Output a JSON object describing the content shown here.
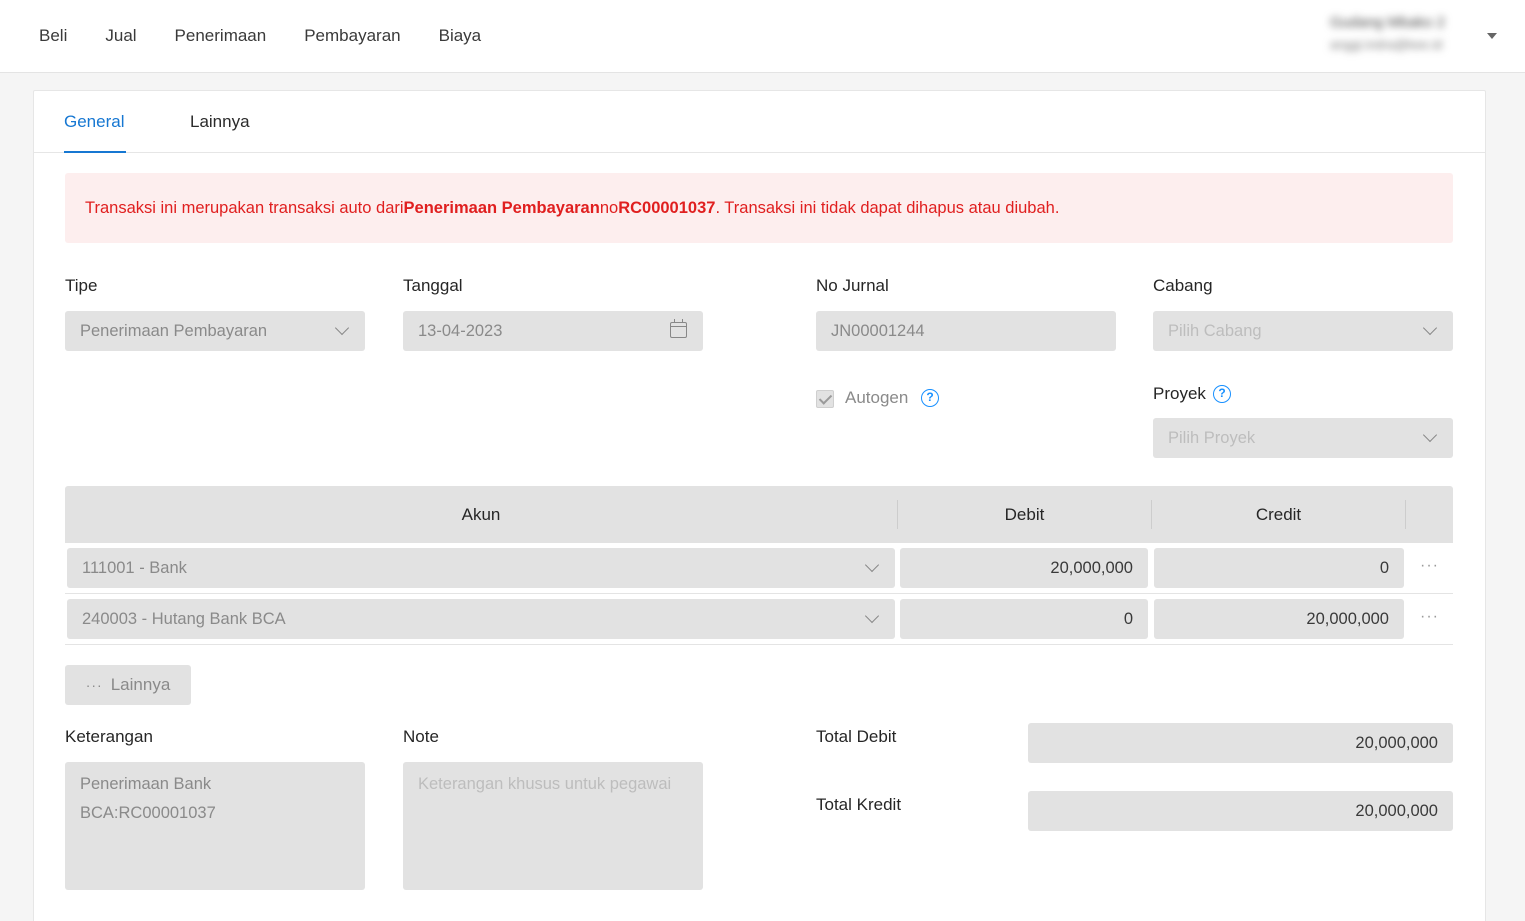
{
  "nav": {
    "items": [
      "Beli",
      "Jual",
      "Penerimaan",
      "Pembayaran",
      "Biaya"
    ],
    "user_name": "Gudang Mbako 2",
    "user_email": "anggi.indra@kee.id"
  },
  "tabs": [
    "General",
    "Lainnya"
  ],
  "alert": {
    "prefix": "Transaksi ini merupakan transaksi auto dari ",
    "source": "Penerimaan Pembayaran",
    "middle": " no ",
    "ref": "RC00001037",
    "suffix": ". Transaksi ini tidak dapat dihapus atau diubah."
  },
  "form": {
    "tipe_label": "Tipe",
    "tipe_value": "Penerimaan Pembayaran",
    "tanggal_label": "Tanggal",
    "tanggal_value": "13-04-2023",
    "no_jurnal_label": "No Jurnal",
    "no_jurnal_value": "JN00001244",
    "cabang_label": "Cabang",
    "cabang_placeholder": "Pilih Cabang",
    "autogen_label": "Autogen",
    "proyek_label": "Proyek",
    "proyek_placeholder": "Pilih Proyek"
  },
  "table": {
    "headers": [
      "Akun",
      "Debit",
      "Credit"
    ],
    "rows": [
      {
        "akun": "111001 - Bank",
        "debit": "20,000,000",
        "credit": "0"
      },
      {
        "akun": "240003 - Hutang Bank BCA",
        "debit": "0",
        "credit": "20,000,000"
      }
    ],
    "more_label": "Lainnya"
  },
  "footer": {
    "keterangan_label": "Keterangan",
    "keterangan_value": "Penerimaan Bank\nBCA:RC00001037",
    "note_label": "Note",
    "note_placeholder": "Keterangan khusus untuk pegawai",
    "total_debit_label": "Total Debit",
    "total_debit_value": "20,000,000",
    "total_kredit_label": "Total Kredit",
    "total_kredit_value": "20,000,000"
  },
  "colors": {
    "accent": "#1677d2",
    "alert_bg": "#fdeeee",
    "alert_text": "#e01f1f",
    "field_bg": "#e2e2e2"
  }
}
